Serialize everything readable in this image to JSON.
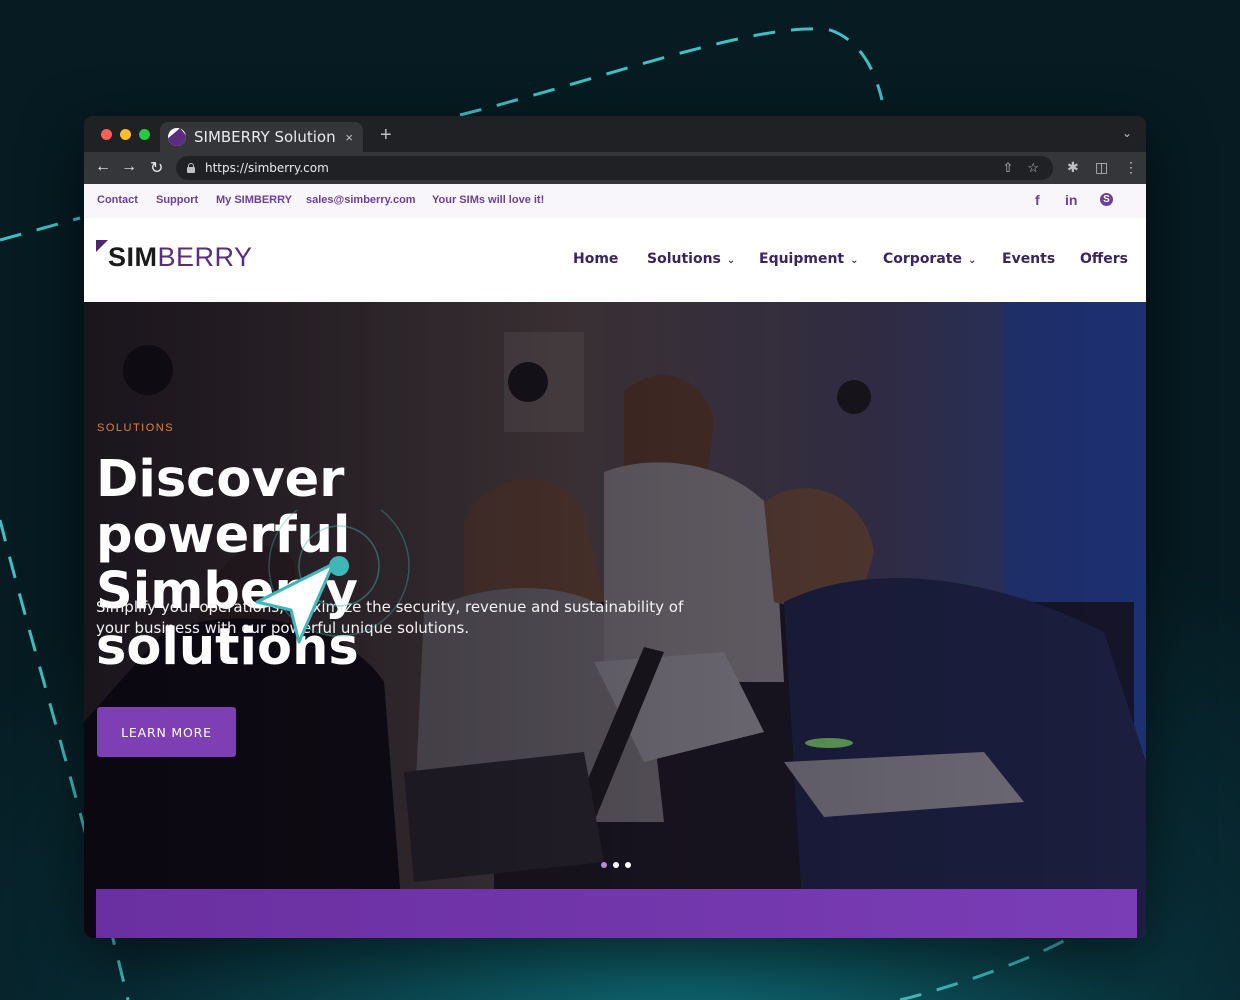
{
  "browser": {
    "tab_title": "SIMBERRY Solution",
    "tab_close": "×",
    "new_tab": "+",
    "url": "https://simberry.com",
    "traffic_lights": [
      "#ff5f57",
      "#febc2e",
      "#28c840"
    ]
  },
  "topbar": {
    "links": [
      "Contact",
      "Support",
      "My SIMBERRY",
      "sales@simberry.com",
      "Your SIMs will love it!"
    ],
    "social": [
      "facebook-icon",
      "linkedin-icon",
      "skype-icon"
    ],
    "social_glyphs": [
      "f",
      "in",
      "S"
    ]
  },
  "logo": {
    "sim": "SIM",
    "berry": "BERRY"
  },
  "nav": {
    "items": [
      {
        "label": "Home",
        "dropdown": false
      },
      {
        "label": "Solutions",
        "dropdown": true
      },
      {
        "label": "Equipment",
        "dropdown": true
      },
      {
        "label": "Corporate",
        "dropdown": true
      },
      {
        "label": "Events",
        "dropdown": false
      },
      {
        "label": "Offers",
        "dropdown": false
      }
    ]
  },
  "hero": {
    "eyebrow": "SOLUTIONS",
    "title": "Discover powerful Simberry solutions",
    "lead": "Simplify your operations, maximize the security, revenue and sustainability of your business with our powerful unique solutions.",
    "cta": "LEARN MORE",
    "slides": 3,
    "active_slide": 1
  },
  "colors": {
    "brand_purple": "#5a2d82",
    "accent_orange": "#e2823a",
    "button_purple": "#7e3fb4",
    "cursor_teal": "#3fb6b8"
  }
}
